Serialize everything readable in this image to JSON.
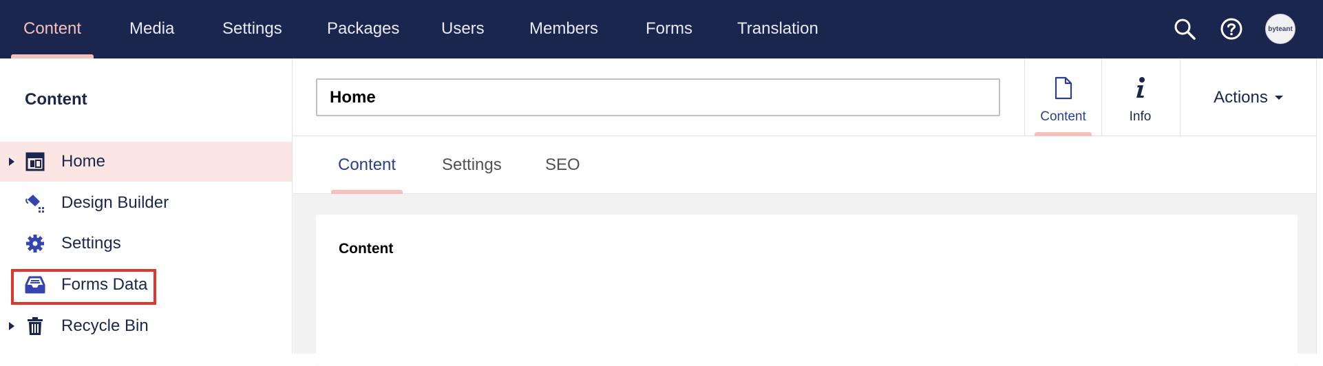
{
  "topnav": {
    "items": [
      {
        "label": "Content"
      },
      {
        "label": "Media"
      },
      {
        "label": "Settings"
      },
      {
        "label": "Packages"
      },
      {
        "label": "Users"
      },
      {
        "label": "Members"
      },
      {
        "label": "Forms"
      },
      {
        "label": "Translation"
      }
    ],
    "active": "Content",
    "avatar_text": "byteant"
  },
  "sidebar": {
    "title": "Content",
    "items": [
      {
        "label": "Home",
        "icon": "layout-icon",
        "has_children": true,
        "selected": true
      },
      {
        "label": "Design Builder",
        "icon": "paint-bucket-icon",
        "has_children": false
      },
      {
        "label": "Settings",
        "icon": "gear-icon",
        "has_children": false
      },
      {
        "label": "Forms Data",
        "icon": "inbox-tray-icon",
        "has_children": false,
        "highlighted": true
      },
      {
        "label": "Recycle Bin",
        "icon": "trash-icon",
        "has_children": true
      }
    ]
  },
  "editor": {
    "name_value": "Home",
    "apps": [
      {
        "label": "Content",
        "icon": "document-icon",
        "active": true
      },
      {
        "label": "Info",
        "icon": "info-icon",
        "active": false
      }
    ],
    "actions_label": "Actions",
    "tabs": [
      {
        "label": "Content",
        "active": true
      },
      {
        "label": "Settings",
        "active": false
      },
      {
        "label": "SEO",
        "active": false
      }
    ],
    "panel_title": "Content"
  },
  "colors": {
    "topbar_bg": "#1b264f",
    "accent_pink": "#f5c1bc",
    "selected_row": "#fbe6e3",
    "highlight_red": "#e0372c",
    "icon_blue": "#3544b1"
  }
}
